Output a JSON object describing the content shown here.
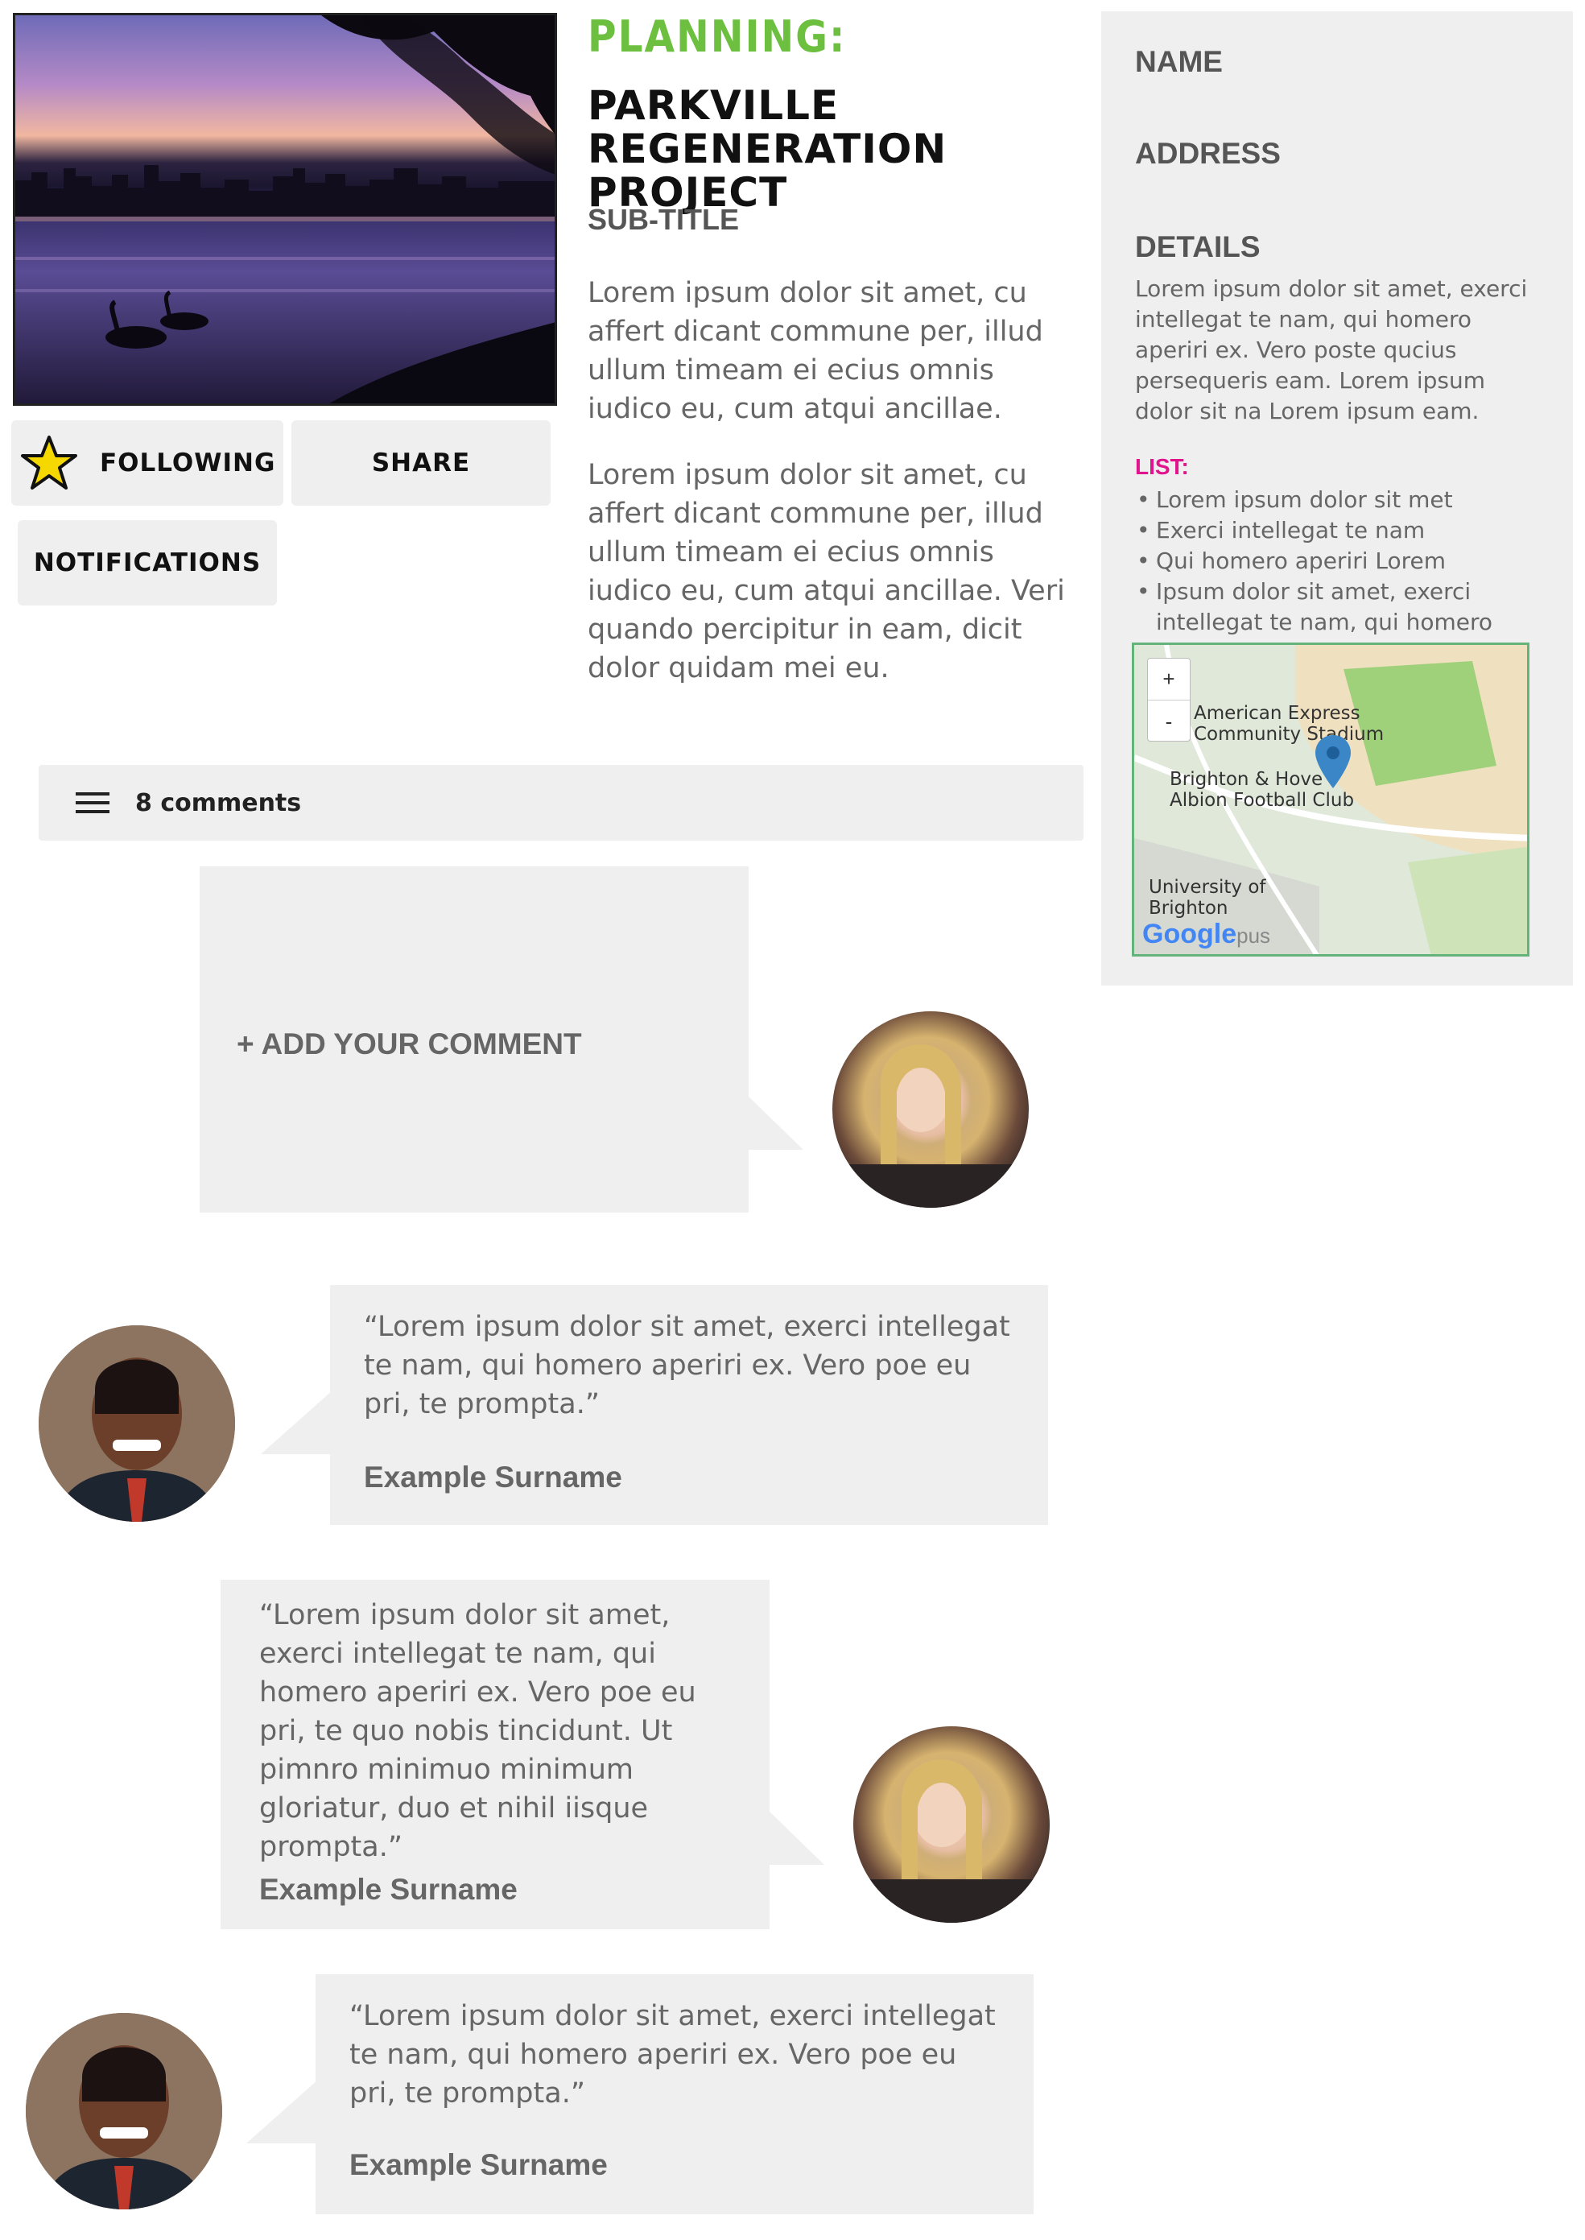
{
  "project": {
    "category": "PLANNING:",
    "title": "PARKVILLE REGENERATION PROJECT",
    "subtitle": "SUB-TITLE",
    "paragraphs": [
      "Lorem ipsum dolor sit amet, cu affert dicant commune per, illud ullum timeam ei ecius omnis iudico eu, cum atqui ancillae.",
      "Lorem ipsum dolor sit amet, cu affert dicant commune per, illud ullum timeam ei ecius omnis iudico eu, cum atqui ancillae. Veri quando percipitur in eam, dicit dolor quidam mei eu."
    ]
  },
  "actions": {
    "following": "FOLLOWING",
    "share": "SHARE",
    "notifications": "NOTIFICATIONS"
  },
  "panel": {
    "name_label": "NAME",
    "address_label": "ADDRESS",
    "details_label": "DETAILS",
    "details_text": "Lorem ipsum dolor sit amet, exerci intellegat te nam, qui homero aperiri ex. Vero poste qucius persequeris eam. Lorem ipsum dolor sit na Lorem ipsum eam.",
    "list_label": "LIST:",
    "list_items": [
      "Lorem ipsum dolor sit met",
      "Exerci intellegat te nam",
      "Qui homero aperiri Lorem",
      "Ipsum dolor sit amet, exerci intellegat te nam, qui homero"
    ],
    "map": {
      "zoom_in": "+",
      "zoom_out": "-",
      "label_stadium": "American Express Community Stadium",
      "label_club": "Brighton & Hove Albion Football Club",
      "label_university": "University of Brighton",
      "google": "Google",
      "suffix": "pus",
      "colors": {
        "grass": "#cfe3b8",
        "pitch": "#9fd07a",
        "stand": "#efe1c0",
        "pin": "#3b86c6"
      }
    }
  },
  "comments": {
    "count_label": "8 comments",
    "add_label": "+ ADD YOUR COMMENT",
    "items": [
      {
        "text": "“Lorem ipsum dolor sit amet, exerci intellegat te nam, qui homero aperiri ex. Vero poe eu pri, te prompta.”",
        "author": "Example Surname"
      },
      {
        "text": "“Lorem ipsum dolor sit amet, exerci intellegat te nam, qui homero aperiri ex. Vero poe eu pri, te quo nobis tincidunt. Ut pimnro minimuo minimum gloriatur, duo et nihil iisque prompta.”",
        "author": "Example Surname"
      },
      {
        "text": "“Lorem ipsum dolor sit amet, exerci intellegat te nam, qui homero aperiri ex. Vero poe eu pri, te prompta.”",
        "author": "Example Surname"
      }
    ]
  },
  "icons": {
    "star": "star-icon",
    "menu": "menu-icon",
    "pin": "map-pin-icon"
  },
  "colors": {
    "accent_green": "#6cbf3f",
    "accent_pink": "#e0148c",
    "panel_bg": "#efefef",
    "star_fill": "#f5d800"
  }
}
